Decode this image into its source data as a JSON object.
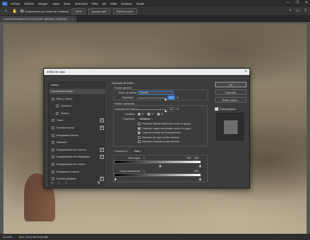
{
  "menubar": {
    "logo": "Ps",
    "items": [
      "Archivo",
      "Edición",
      "Imagen",
      "Capa",
      "Texto",
      "Selección",
      "Filtro",
      "3D",
      "Vista",
      "Ventana",
      "Ayuda"
    ],
    "controls": [
      "—",
      "❐",
      "✕"
    ]
  },
  "optbar": {
    "sample_all_layers": "Desplazarse por todas las ventanas",
    "zoom": "100%",
    "fit_screen": "Ajustar pant.",
    "fill_screen": "Rellenar pant."
  },
  "doctab": {
    "title": "D1295-SOLARHI al 22% (D1507-8624AH, RGB/16) *",
    "close": "×"
  },
  "statusbar": {
    "zoom": "22,44%",
    "doc": "Doc: 120,2 M/213,8 MB"
  },
  "dialog": {
    "title": "Estilo de capa",
    "close": "✕",
    "left": {
      "header": "Estilos",
      "items": [
        {
          "label": "Opciones de fusión",
          "checkbox": false,
          "plus": false,
          "selected": true
        },
        {
          "label": "Bisel y relieve",
          "checkbox": true,
          "plus": false
        },
        {
          "label": "Contorno",
          "checkbox": true,
          "plus": false,
          "indent": true
        },
        {
          "label": "Textura",
          "checkbox": true,
          "plus": false,
          "indent": true
        },
        {
          "label": "Trazo",
          "checkbox": true,
          "plus": true
        },
        {
          "label": "Sombra interior",
          "checkbox": true,
          "plus": true
        },
        {
          "label": "Resplandor interior",
          "checkbox": true,
          "plus": false
        },
        {
          "label": "Satinado",
          "checkbox": true,
          "plus": false
        },
        {
          "label": "Superposición de colores",
          "checkbox": true,
          "plus": true
        },
        {
          "label": "Superposición de degradado",
          "checkbox": true,
          "plus": true
        },
        {
          "label": "Superposición de motivo",
          "checkbox": true,
          "plus": false
        },
        {
          "label": "Resplandor exterior",
          "checkbox": true,
          "plus": false
        },
        {
          "label": "Sombra paralela",
          "checkbox": true,
          "plus": true
        }
      ],
      "bottom_icons": [
        "fx",
        "⇧",
        "⇩"
      ],
      "trash": "🗑"
    },
    "mid": {
      "section_title": "Opciones de fusión",
      "general": {
        "title": "Fusión general",
        "mode_label": "Modo de fusión:",
        "mode_value": "Normal",
        "opacity_label": "Opacidad:",
        "opacity_value": "100",
        "percent": "%",
        "opacity_level": 1.0
      },
      "advanced": {
        "title": "Fusión avanzada",
        "fill_label": "Opacidad de relleno:",
        "fill_value": "100",
        "percent": "%",
        "fill_level": 1.0,
        "channels_label": "Canales:",
        "channels": [
          "R",
          "G",
          "B"
        ],
        "knockout_label": "Cobertura:",
        "knockout_value": "Ninguna",
        "options": [
          {
            "label": "Fusionar efectos interiores como un grupo",
            "checked": false
          },
          {
            "label": "Fusionar capas recortadas como un grupo",
            "checked": true
          },
          {
            "label": "Capa de formas de transparencia",
            "checked": true
          },
          {
            "label": "Máscara de capa oculta efectos",
            "checked": false
          },
          {
            "label": "Máscara vectorial oculta efectos",
            "checked": false
          }
        ]
      },
      "blend_if": {
        "label": "Fusionar si:",
        "value": "Gris",
        "this_layer_label": "Esta capa:",
        "this_low": "0",
        "this_high": "255",
        "this_high2": "255",
        "underlying_label": "Capa subyacente:",
        "under_low": "0",
        "under_high": "255"
      }
    },
    "right": {
      "ok": "OK",
      "cancel": "Cancelar",
      "new_style": "Estilo nuevo...",
      "preview_label": "Previsualizar"
    }
  }
}
